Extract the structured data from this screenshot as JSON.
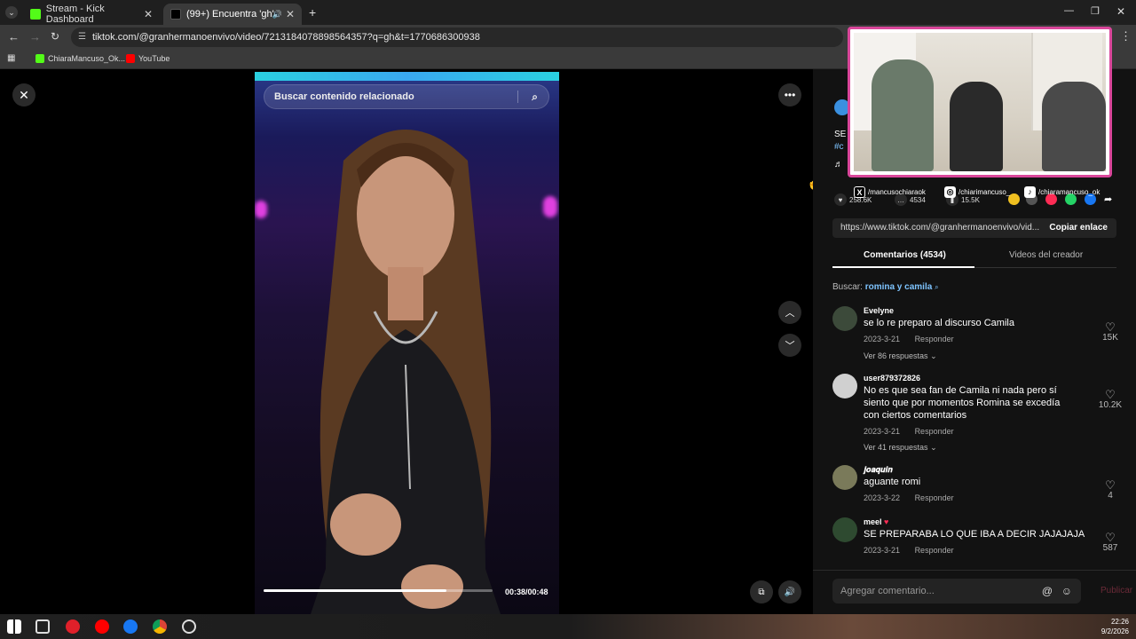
{
  "browser": {
    "tabs": [
      {
        "label": "Stream - Kick Dashboard"
      },
      {
        "label": "(99+) Encuentra 'gh' en TikT..."
      }
    ],
    "url": "tiktok.com/@granhermanoenvivo/video/7213184078898564357?q=gh&t=1770686300938",
    "bookmarks": [
      {
        "label": "ChiaraMancuso_Ok..."
      },
      {
        "label": "YouTube"
      }
    ]
  },
  "video": {
    "search_placeholder": "Buscar contenido relacionado",
    "progress_fraction": 0.8,
    "time": "00:38/00:48"
  },
  "stats": {
    "likes": "258.6K",
    "comments": "4534",
    "saves": "15.5K"
  },
  "socials": [
    {
      "label": "/mancusochiaraok"
    },
    {
      "label": "/chiarimancuso_"
    },
    {
      "label": "/chiaramancuso_ok"
    }
  ],
  "link": {
    "url": "https://www.tiktok.com/@granhermanoenvivo/vid...",
    "copy_label": "Copiar enlace"
  },
  "tabs": {
    "comments": "Comentarios (4534)",
    "creator_videos": "Videos del creador"
  },
  "search_query": {
    "prefix": "Buscar:",
    "query": "romina y camila"
  },
  "comments": [
    {
      "user": "Evelyne",
      "text": "se lo re preparo al discurso Camila",
      "date": "2023-3-21",
      "reply": "Responder",
      "replies": "Ver 86 respuestas",
      "likes": "15K"
    },
    {
      "user": "user879372826",
      "text": "No es que sea fan de Camila ni nada pero sí siento que por momentos Romina se excedía con ciertos comentarios",
      "date": "2023-3-21",
      "reply": "Responder",
      "replies": "Ver 41 respuestas",
      "likes": "10.2K"
    },
    {
      "user": "𝒋𝒐𝒂𝒒𝒖𝒊𝒏",
      "text": "aguante romi",
      "date": "2023-3-22",
      "reply": "Responder",
      "likes": "4"
    },
    {
      "user": "meel",
      "text": "SE PREPARABA LO QUE IBA A DECIR JAJAJAJA",
      "date": "2023-3-21",
      "reply": "Responder",
      "likes": "587"
    }
  ],
  "comment_input": {
    "placeholder": "Agregar comentario...",
    "publish": "Publicar"
  },
  "taskbar": {
    "time": "22:26",
    "date": "9/2/2026"
  },
  "colors": {
    "accent_pink": "#fe2c55",
    "link_blue": "#7ec4ff",
    "webcam_border": "#d9469a"
  }
}
